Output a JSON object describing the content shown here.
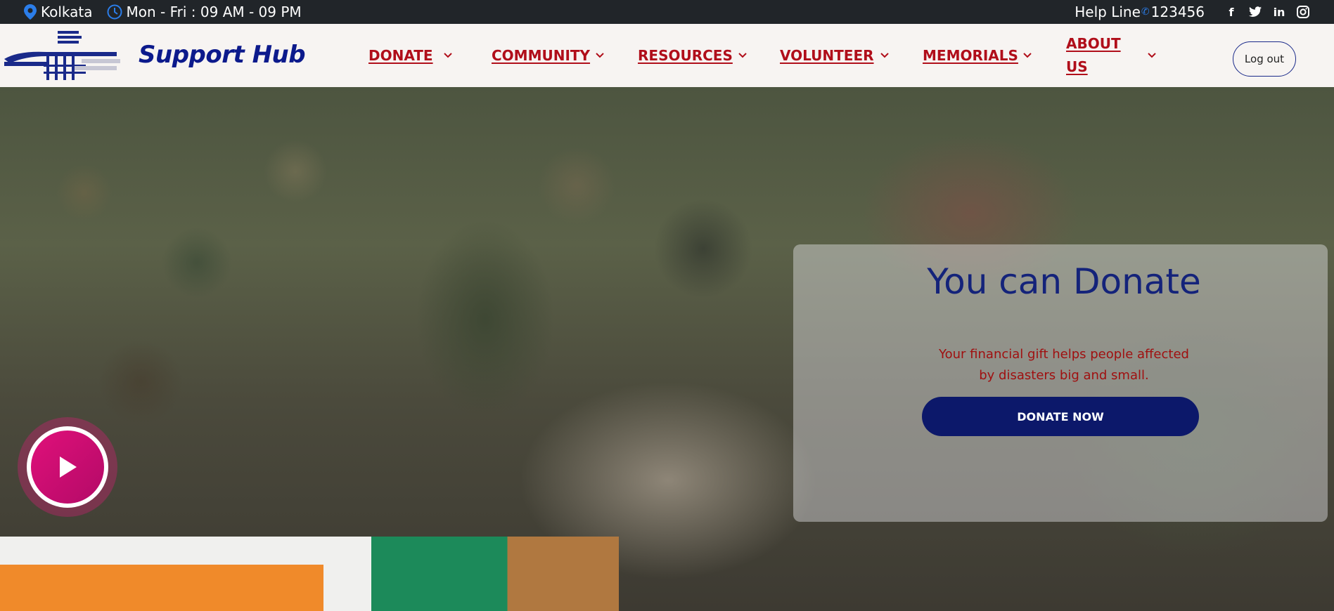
{
  "topbar": {
    "location": "Kolkata",
    "hours": "Mon - Fri : 09 AM - 09 PM",
    "helpline_label": "Help Line",
    "helpline_number": "123456",
    "social": [
      "facebook-icon",
      "twitter-icon",
      "linkedin-icon",
      "instagram-icon"
    ]
  },
  "header": {
    "brand": "Support Hub",
    "nav": [
      {
        "label": "DONATE"
      },
      {
        "label": "COMMUNITY"
      },
      {
        "label": "RESOURCES"
      },
      {
        "label": "VOLUNTEER"
      },
      {
        "label": "MEMORIALS"
      },
      {
        "label": "ABOUT US"
      }
    ],
    "logout_label": "Log out"
  },
  "hero": {
    "donate_title": "You can Donate",
    "donate_text": "Your financial gift helps people affected by disasters big and small.",
    "donate_button": "DONATE NOW"
  },
  "colors": {
    "topbar_bg": "#212529",
    "brand": "#0c1a8c",
    "nav": "#b00e1a",
    "donate_button": "#0c186a",
    "play": "#e0107a"
  }
}
